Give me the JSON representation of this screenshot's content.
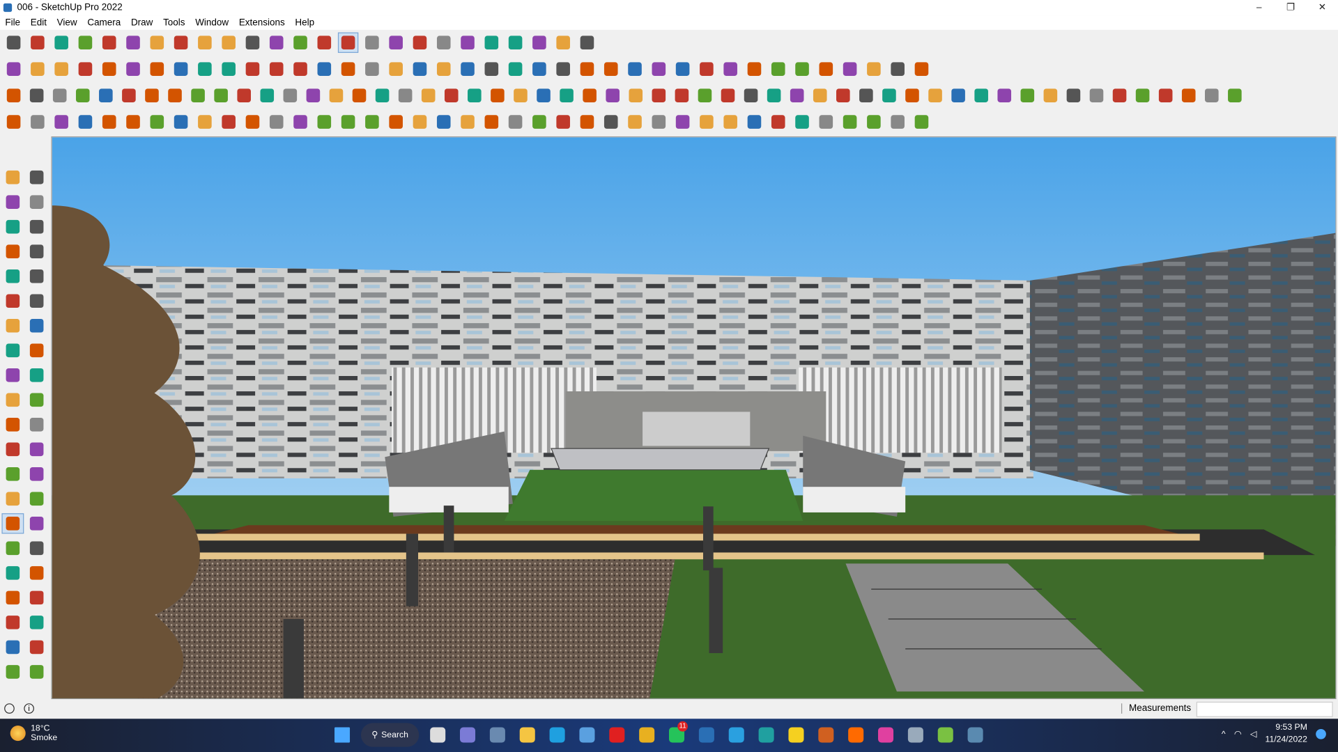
{
  "window": {
    "title": "006 - SketchUp Pro 2022",
    "minimize": "–",
    "restore": "❐",
    "close": "✕"
  },
  "menu": [
    "File",
    "Edit",
    "View",
    "Camera",
    "Draw",
    "Tools",
    "Window",
    "Extensions",
    "Help"
  ],
  "toolbars": {
    "row1": [
      "zoom-extents-icon",
      "select-icon",
      "eraser-icon",
      "line-icon",
      "arc-icon",
      "rectangle-icon",
      "push-pull-icon",
      "follow-me-icon",
      "move-icon",
      "rotate-icon",
      "scale-icon",
      "tape-measure-icon",
      "text-icon",
      "paint-bucket-icon",
      "orbit-icon",
      "pan-icon",
      "zoom-icon",
      "zoom-window-icon",
      "warehouse-icon",
      "extension-warehouse-icon",
      "layout-icon",
      "extension-manager-icon",
      "profile-icon",
      "sandbox-icon",
      "styles-icon"
    ],
    "row2": [
      "iso-view-icon",
      "top-view-icon",
      "front-view-icon",
      "right-view-icon",
      "back-view-icon",
      "left-view-icon",
      "xray-icon",
      "back-edges-icon",
      "wireframe-icon",
      "hidden-line-icon",
      "shaded-icon",
      "textured-icon",
      "monochrome-icon",
      "section-plane-icon",
      "section-cut-icon",
      "section-fill-icon",
      "solid-union-icon",
      "pen-icon",
      "circle-icon",
      "polygon-icon",
      "ellipse-icon",
      "ellipse2-icon",
      "parallelogram-icon",
      "arc3-icon",
      "ring-icon",
      "offset-icon",
      "shape-bender-icon",
      "gradient-icon",
      "eraser2-icon",
      "arrow-up-icon",
      "stack-icon",
      "push-blue-icon",
      "push-red-icon",
      "push-green-icon",
      "push-n-icon",
      "push-x-icon",
      "push-f-icon",
      "plane-icon",
      "house-icon"
    ],
    "row3": [
      "components-icon",
      "table-icon",
      "ring-icon",
      "roof-icon",
      "shed-icon",
      "spark-icon",
      "dome-icon",
      "sphere-icon",
      "group-icon",
      "explode-icon",
      "cube-1-icon",
      "cube-2-icon",
      "cube-3-icon",
      "sphere2-icon",
      "sphere3-icon",
      "lock-icon",
      "curve-1-icon",
      "curve-2-icon",
      "loft-1-icon",
      "loft-2-icon",
      "loft-3-icon",
      "rotate2-icon",
      "align-icon",
      "stack2-icon",
      "frame-icon",
      "frame2-icon",
      "frame3-icon",
      "frame4-icon",
      "bezier-icon",
      "polyline-icon",
      "weld-icon",
      "cut-icon",
      "gear-icon",
      "cloth-icon",
      "hook-icon",
      "bowl-icon",
      "mask-icon",
      "knife-icon",
      "corner-icon",
      "corner2-icon",
      "line2-icon",
      "curve3-icon",
      "chair-icon",
      "sail-icon",
      "fence-icon",
      "fence2-icon",
      "glove-icon",
      "leaf-icon",
      "arrow-left-icon",
      "stairs-icon",
      "ruler-icon",
      "fork-icon",
      "fork2-icon",
      "fork3-icon"
    ],
    "row4": [
      "layer-blue-icon",
      "layer-blue2-icon",
      "layer-yellow-icon",
      "layer-green-icon",
      "layer-red-icon",
      "layer-stack-icon",
      "undo-curve-icon",
      "square-red-icon",
      "list-icon",
      "page-icon",
      "box-icon",
      "link-icon",
      "hook2-icon",
      "spline-icon",
      "plus-red-icon",
      "plus-green-icon",
      "x-blue-icon",
      "cone-icon",
      "cone2-icon",
      "triangle-icon",
      "lasso-icon",
      "lasso2-icon",
      "lasso3-icon",
      "move2-icon",
      "box2-icon",
      "undo-red-icon",
      "tree-icon",
      "cube-move-icon",
      "cube-move2-icon",
      "cube-move3-icon",
      "tag-icon",
      "grid-icon",
      "panel-icon",
      "grid2-icon",
      "grid3-icon",
      "grid4-icon",
      "scatter-icon",
      "circle-dash-icon",
      "components2-icon"
    ]
  },
  "palette": [
    "select-icon",
    "orbit-icon",
    "paint-bucket-icon",
    "eraser-icon",
    "components-icon",
    "tape-icon",
    "line-icon",
    "freehand-icon",
    "rectangle-icon",
    "rotated-rect-icon",
    "circle-icon",
    "polygon-icon",
    "arc-icon",
    "arc2-icon",
    "pie-icon",
    "arc3-icon",
    "move-icon",
    "push-pull-icon",
    "rotate-icon",
    "follow-me-icon",
    "scale-icon",
    "offset-icon",
    "tape-measure-icon",
    "dimension-icon",
    "protractor-icon",
    "text-icon",
    "axes-icon",
    "3d-text-icon",
    "orbit-active-icon",
    "pan-icon",
    "zoom-icon",
    "zoom-window-icon",
    "zoom-extents-icon",
    "previous-view-icon",
    "position-camera-icon",
    "look-around-icon",
    "walk-icon",
    "section-plane-icon",
    "warehouse-icon",
    "extension-warehouse-icon",
    "layout-icon",
    "extension-manager-icon"
  ],
  "status": {
    "measurements_label": "Measurements",
    "measurements_value": ""
  },
  "taskbar": {
    "temperature": "18°C",
    "weather": "Smoke",
    "search": "Search",
    "whatsapp_badge": "11",
    "time": "9:53 PM",
    "date": "11/24/2022",
    "apps": [
      "task-view-icon",
      "teams-icon",
      "calculator-icon",
      "file-explorer-icon",
      "edge-icon",
      "store-icon",
      "opera-icon",
      "chrome-icon",
      "whatsapp-icon",
      "sketchup-icon",
      "telegram-icon",
      "app-icon",
      "sticky-notes-icon",
      "grammarly-icon",
      "soundcloud-icon",
      "instagram-icon",
      "monitor-icon",
      "utorrent-icon",
      "layout-icon"
    ],
    "app_colors": [
      "#ddd",
      "#7b7bd6",
      "#6a8ab0",
      "#f5c542",
      "#1fa0e0",
      "#5aa0e0",
      "#e02020",
      "#e8b020",
      "#25c35a",
      "#2a6fb5",
      "#2aa0e0",
      "#20a0a0",
      "#f5d020",
      "#d06020",
      "#ff6a00",
      "#e040a0",
      "#9ab",
      "#7ac142",
      "#5a8ab0"
    ]
  },
  "accent": "#2a6fb5"
}
